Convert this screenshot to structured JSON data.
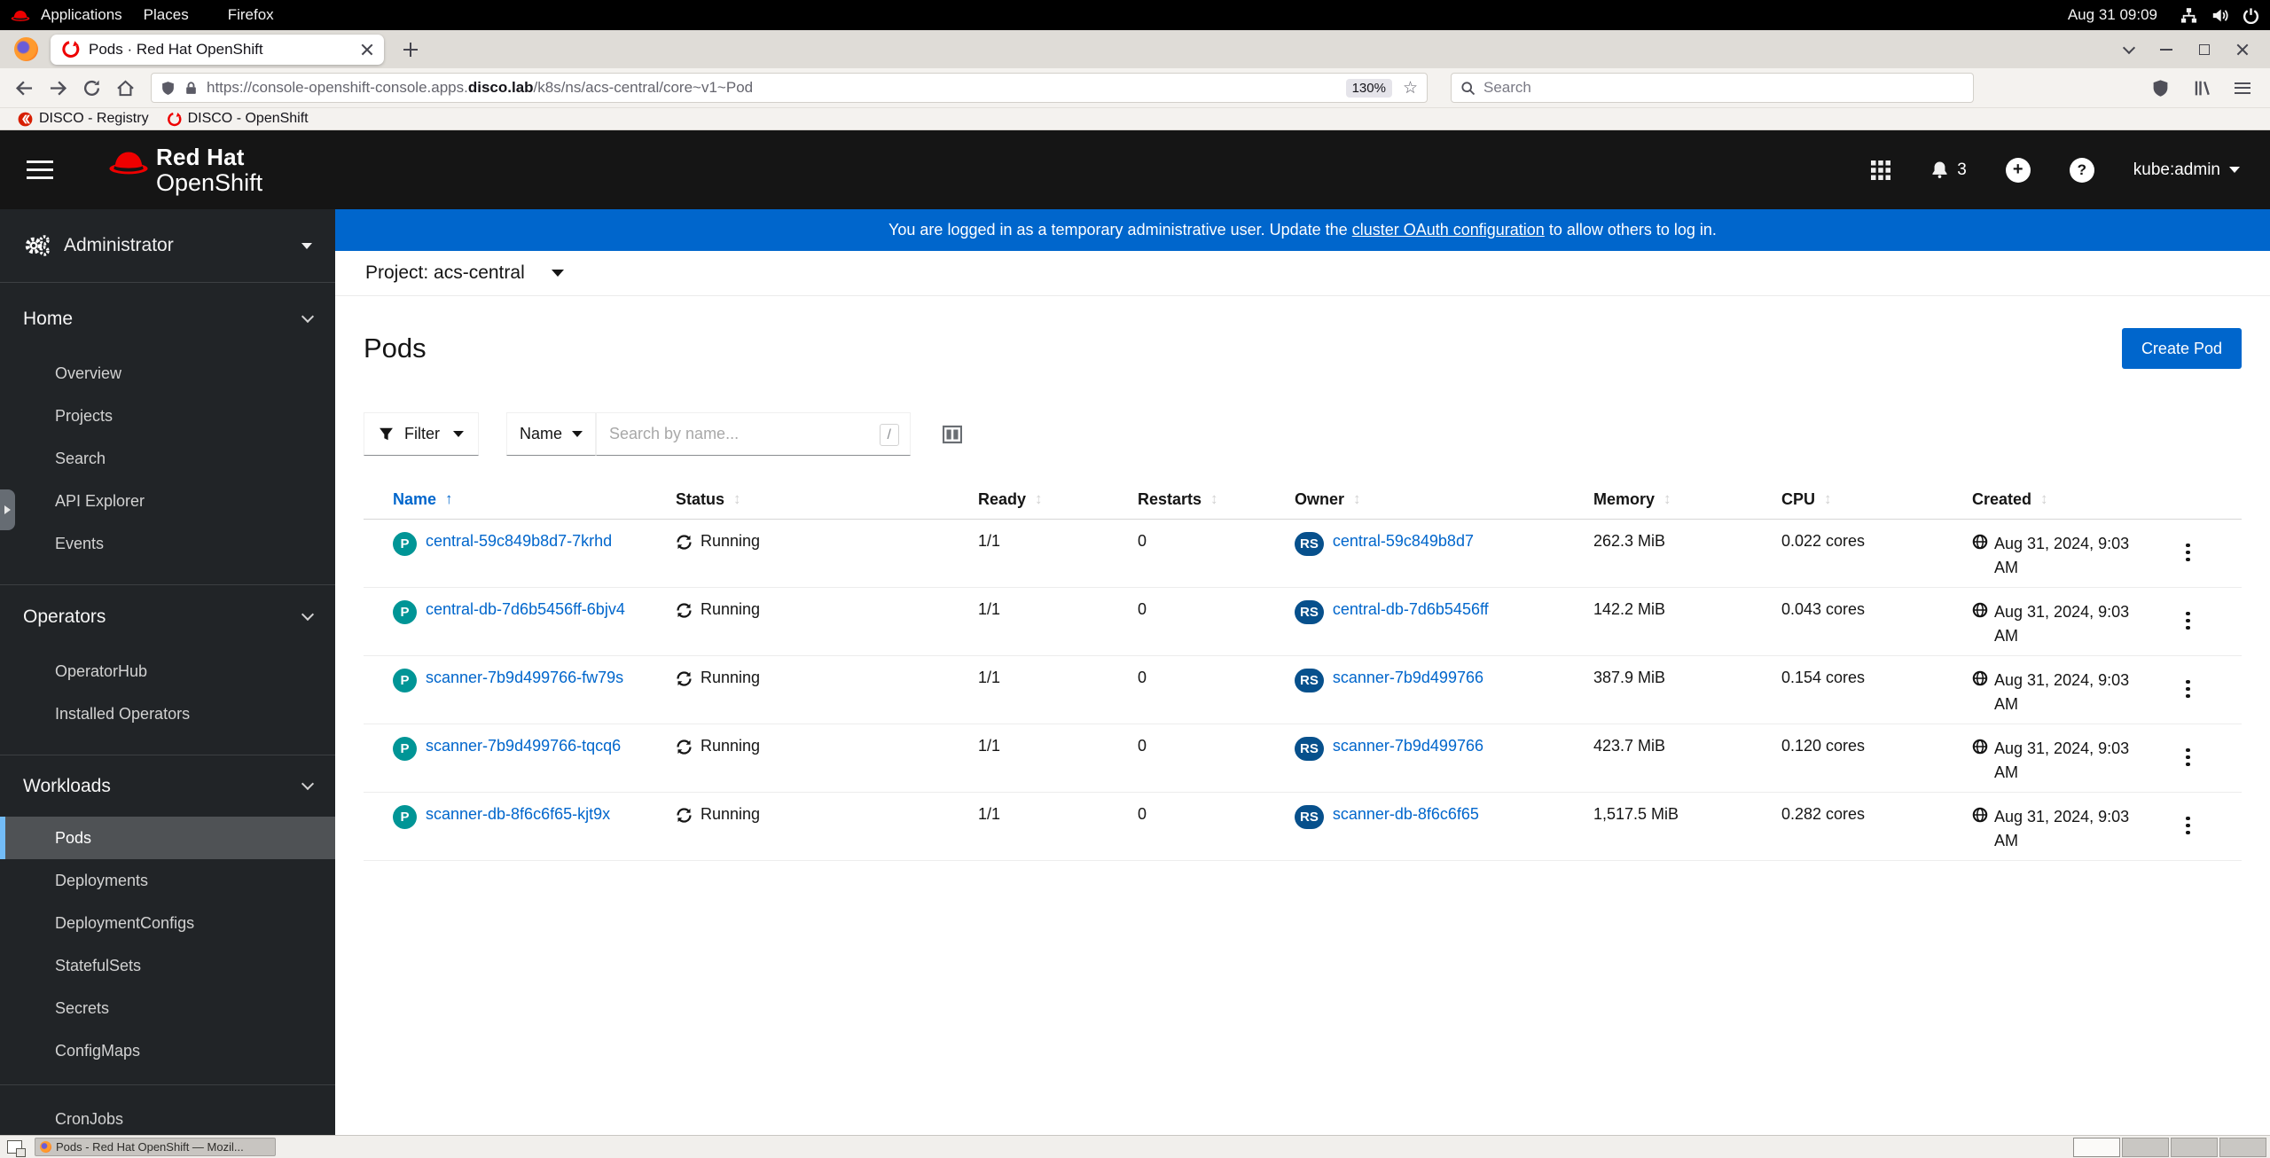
{
  "desktop": {
    "topbar": {
      "menu_apps": "Applications",
      "menu_places": "Places",
      "menu_firefox": "Firefox",
      "clock": "Aug 31 09:09"
    },
    "taskbar": {
      "active_task": "Pods - Red Hat OpenShift — Mozil..."
    }
  },
  "browser": {
    "tab_title": "Pods · Red Hat OpenShift",
    "url_prefix": "https://console-openshift-console.apps.",
    "url_domain": "disco.lab",
    "url_path": "/k8s/ns/acs-central/core~v1~Pod",
    "zoom_level": "130%",
    "search_placeholder": "Search",
    "bookmark_registry": "DISCO - Registry",
    "bookmark_openshift": "DISCO - OpenShift"
  },
  "masthead": {
    "brand_top": "Red Hat",
    "brand_bottom": "OpenShift",
    "notification_count": "3",
    "username": "kube:admin"
  },
  "banner": {
    "before": "You are logged in as a temporary administrative user. Update the ",
    "link": "cluster OAuth configuration",
    "after": " to allow others to log in."
  },
  "project_selector": {
    "label": "Project: acs-central"
  },
  "sidebar": {
    "perspective": "Administrator",
    "sections": [
      {
        "label": "Home",
        "items": [
          "Overview",
          "Projects",
          "Search",
          "API Explorer",
          "Events"
        ]
      },
      {
        "label": "Operators",
        "items": [
          "OperatorHub",
          "Installed Operators"
        ]
      },
      {
        "label": "Workloads",
        "active_item": "Pods",
        "items": [
          "Pods",
          "Deployments",
          "DeploymentConfigs",
          "StatefulSets",
          "Secrets",
          "ConfigMaps",
          "CronJobs"
        ]
      }
    ]
  },
  "page": {
    "title": "Pods",
    "create_button": "Create Pod",
    "toolbar": {
      "filter": "Filter",
      "search_attribute": "Name",
      "search_placeholder": "Search by name...",
      "shortcut_hint": "/"
    },
    "table": {
      "pod_badge": "P",
      "owner_badge": "RS",
      "columns": [
        "Name",
        "Status",
        "Ready",
        "Restarts",
        "Owner",
        "Memory",
        "CPU",
        "Created"
      ],
      "rows": [
        {
          "name": "central-59c849b8d7-7krhd",
          "status": "Running",
          "ready": "1/1",
          "restarts": "0",
          "owner": "central-59c849b8d7",
          "memory": "262.3 MiB",
          "cpu": "0.022 cores",
          "created": "Aug 31, 2024, 9:03 AM"
        },
        {
          "name": "central-db-7d6b5456ff-6bjv4",
          "status": "Running",
          "ready": "1/1",
          "restarts": "0",
          "owner": "central-db-7d6b5456ff",
          "memory": "142.2 MiB",
          "cpu": "0.043 cores",
          "created": "Aug 31, 2024, 9:03 AM"
        },
        {
          "name": "scanner-7b9d499766-fw79s",
          "status": "Running",
          "ready": "1/1",
          "restarts": "0",
          "owner": "scanner-7b9d499766",
          "memory": "387.9 MiB",
          "cpu": "0.154 cores",
          "created": "Aug 31, 2024, 9:03 AM"
        },
        {
          "name": "scanner-7b9d499766-tqcq6",
          "status": "Running",
          "ready": "1/1",
          "restarts": "0",
          "owner": "scanner-7b9d499766",
          "memory": "423.7 MiB",
          "cpu": "0.120 cores",
          "created": "Aug 31, 2024, 9:03 AM"
        },
        {
          "name": "scanner-db-8f6c6f65-kjt9x",
          "status": "Running",
          "ready": "1/1",
          "restarts": "0",
          "owner": "scanner-db-8f6c6f65",
          "memory": "1,517.5 MiB",
          "cpu": "0.282 cores",
          "created": "Aug 31, 2024, 9:03 AM"
        }
      ]
    }
  },
  "icons": {
    "sort": "↕",
    "sort_asc": "↑",
    "plus": "+",
    "help": "?",
    "star": "☆"
  },
  "colors": {
    "accent_blue": "#0066cc",
    "masthead_bg": "#151515",
    "banner_bg": "#0066cc",
    "pod_badge_bg": "#009596",
    "owner_badge_bg": "#07508c",
    "nav_selected_border": "#73bcf7"
  }
}
